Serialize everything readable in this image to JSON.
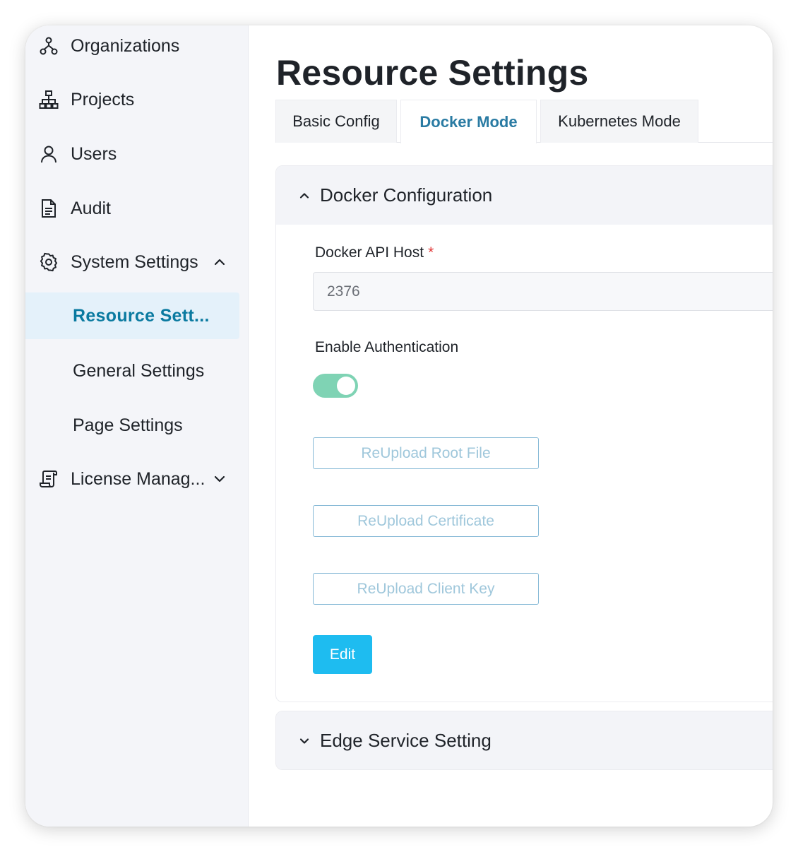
{
  "sidebar": {
    "items": [
      {
        "label": "Organizations",
        "icon": "organizations-icon"
      },
      {
        "label": "Projects",
        "icon": "projects-icon"
      },
      {
        "label": "Users",
        "icon": "user-icon"
      },
      {
        "label": "Audit",
        "icon": "document-icon"
      },
      {
        "label": "System Settings",
        "icon": "gear-icon",
        "expanded": true
      },
      {
        "label": "License Manag...",
        "icon": "license-icon",
        "expanded": false
      }
    ],
    "system_settings_children": [
      {
        "label": "Resource Sett...",
        "active": true
      },
      {
        "label": "General Settings",
        "active": false
      },
      {
        "label": "Page Settings",
        "active": false
      }
    ]
  },
  "main": {
    "title": "Resource Settings",
    "tabs": [
      {
        "label": "Basic Config",
        "active": false
      },
      {
        "label": "Docker Mode",
        "active": true
      },
      {
        "label": "Kubernetes Mode",
        "active": false
      }
    ],
    "docker_panel": {
      "title": "Docker Configuration",
      "expanded": true,
      "api_host_label": "Docker API Host",
      "required_mark": "*",
      "api_host_value": "2376",
      "auth_label": "Enable Authentication",
      "auth_enabled": true,
      "reupload_root_label": "ReUpload Root File",
      "reupload_cert_label": "ReUpload Certificate",
      "reupload_key_label": "ReUpload Client Key",
      "edit_label": "Edit"
    },
    "edge_panel": {
      "title": "Edge Service Setting",
      "expanded": false
    }
  },
  "colors": {
    "accent": "#0a7aa0",
    "primary_button": "#1ebcf0",
    "toggle_on": "#7fd3b4",
    "active_nav_bg": "#e4f1fa",
    "required": "#e23b3b"
  }
}
